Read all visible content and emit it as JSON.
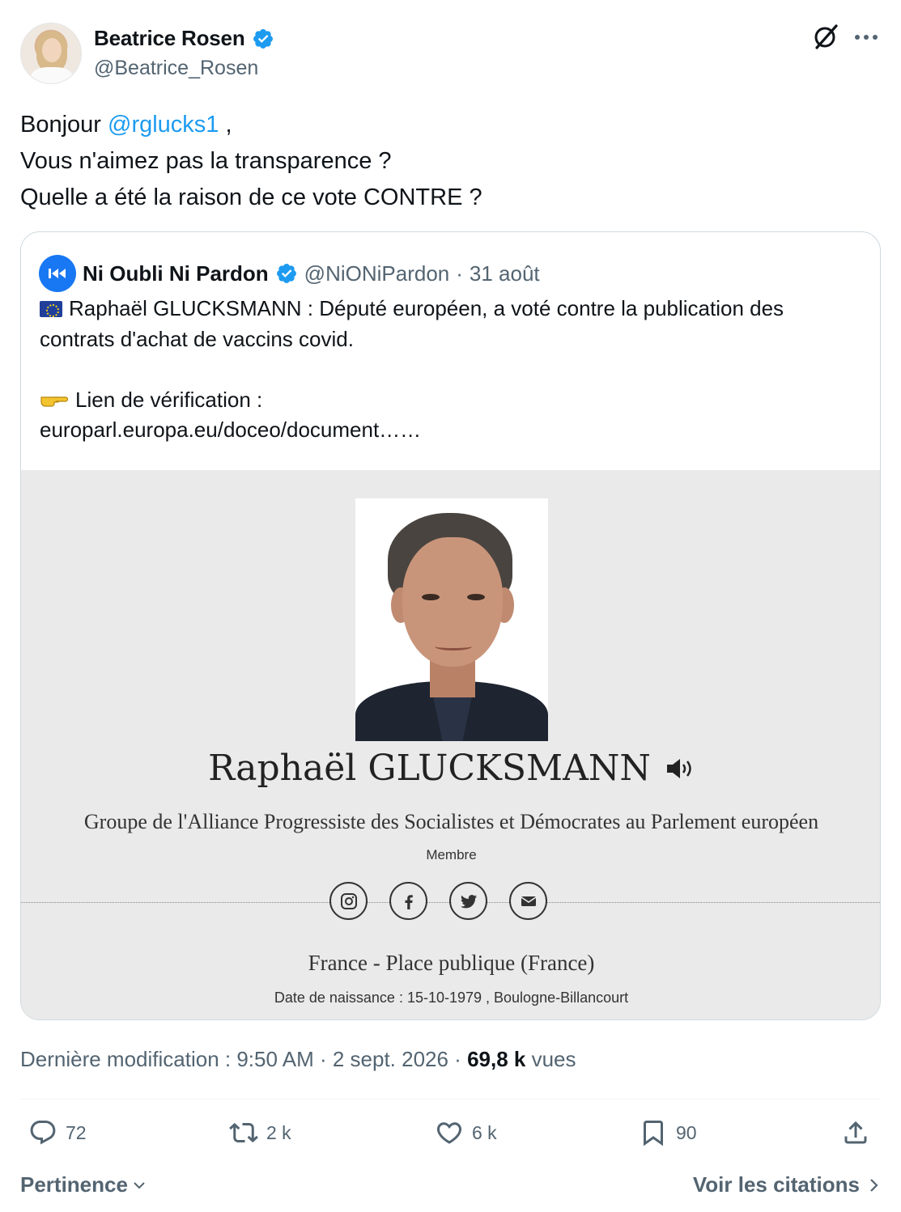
{
  "author": {
    "name": "Beatrice Rosen",
    "handle": "@Beatrice_Rosen",
    "verified": true
  },
  "tweet": {
    "line1_prefix": "Bonjour ",
    "mention": "@rglucks1",
    "line1_suffix": " ,",
    "line2": "Vous n'aimez pas la transparence ?",
    "line3": "Quelle a été la raison de ce vote CONTRE ?"
  },
  "quote": {
    "name": "Ni Oubli Ni Pardon",
    "handle": "@NiONiPardon",
    "dot": "·",
    "date": "31 août",
    "line1": "Raphaël GLUCKSMANN : Député européen, a voté contre la publication des",
    "line2": "contrats d'achat de vaccins covid.",
    "line3": "Lien de vérification :",
    "line4": "europarl.europa.eu/doceo/document……",
    "media": {
      "name": "Raphaël GLUCKSMANN",
      "group": "Groupe de l'Alliance Progressiste des Socialistes et Démocrates au Parlement européen",
      "role": "Membre",
      "country": "France - Place publique (France)",
      "birth": "Date de naissance : 15-10-1979 , Boulogne-Billancourt"
    }
  },
  "meta": {
    "prefix": "Dernière modification : 9:50 AM · 2 sept. 2026 · ",
    "views_count": "69,8 k",
    "views_label": " vues"
  },
  "actions": {
    "replies": "72",
    "reposts": "2 k",
    "likes": "6 k",
    "bookmarks": "90"
  },
  "footer": {
    "sort_label": "Pertinence",
    "quotes_link": "Voir les citations"
  },
  "colors": {
    "accent": "#1d9bf0",
    "text": "#0f1419",
    "muted": "#536471",
    "border": "#cfd9de"
  }
}
